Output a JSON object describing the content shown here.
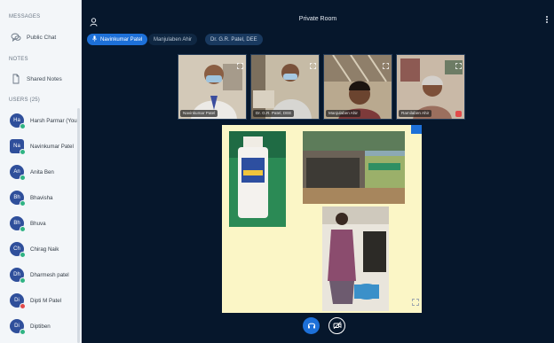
{
  "sidebar": {
    "messages_title": "MESSAGES",
    "public_chat": "Public Chat",
    "notes_title": "NOTES",
    "shared_notes": "Shared Notes",
    "users_title": "USERS (25)",
    "users": [
      {
        "initials": "Ha",
        "name": "Harsh Parmar (You)"
      },
      {
        "initials": "Na",
        "name": "Navinkumar Patel"
      },
      {
        "initials": "An",
        "name": "Anita Ben"
      },
      {
        "initials": "Bh",
        "name": "Bhavisha"
      },
      {
        "initials": "Bh",
        "name": "Bhuva"
      },
      {
        "initials": "Ch",
        "name": "Chirag Naik"
      },
      {
        "initials": "Dh",
        "name": "Dharmesh patel"
      },
      {
        "initials": "Di",
        "name": "Dipti M Patel"
      },
      {
        "initials": "Di",
        "name": "Diptiben"
      }
    ]
  },
  "main": {
    "room_title": "Private Room",
    "talking": [
      "Navinkumar Patel",
      "Manjulaben Ahir",
      "Dr. G.R. Patel, DEE"
    ],
    "tiles": [
      {
        "name": "Navinkumar Patel"
      },
      {
        "name": "Dr. G.R. Patel, DEE"
      },
      {
        "name": "Manjulaben Ahir"
      },
      {
        "name": "Ramilaben Ahir"
      }
    ]
  },
  "colors": {
    "accent": "#1d70d8",
    "main_bg": "#06172c",
    "sidebar_bg": "#f3f6f9",
    "slide_bg": "#fbf6c6",
    "online": "#2fb383",
    "muted": "#e24b4b"
  },
  "icons": [
    "user-icon",
    "chat-icon",
    "notes-icon",
    "more-icon",
    "mic-icon",
    "fullscreen-icon",
    "headphones-icon",
    "camera-icon"
  ]
}
